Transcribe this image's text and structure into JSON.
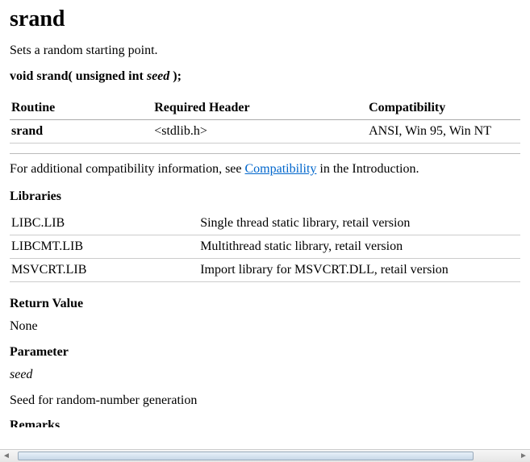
{
  "title": "srand",
  "summary": "Sets a random starting point.",
  "signature": {
    "prefix": "void srand( unsigned int ",
    "param": "seed",
    "suffix": " );"
  },
  "compat_table": {
    "headers": [
      "Routine",
      "Required Header",
      "Compatibility"
    ],
    "rows": [
      {
        "routine": "srand",
        "header": "<stdlib.h>",
        "compat": "ANSI, Win 95, Win NT"
      }
    ]
  },
  "compat_note": {
    "before": "For additional compatibility information, see ",
    "link": "Compatibility",
    "after": " in the Introduction."
  },
  "libraries": {
    "heading": "Libraries",
    "rows": [
      {
        "name": "LIBC.LIB",
        "desc": "Single thread static library, retail version"
      },
      {
        "name": "LIBCMT.LIB",
        "desc": "Multithread static library, retail version"
      },
      {
        "name": "MSVCRT.LIB",
        "desc": "Import library for MSVCRT.DLL, retail version"
      }
    ]
  },
  "return_value": {
    "heading": "Return Value",
    "text": "None"
  },
  "parameter": {
    "heading": "Parameter",
    "name": "seed",
    "desc": "Seed for random-number generation"
  },
  "remarks_heading": "Remarks"
}
